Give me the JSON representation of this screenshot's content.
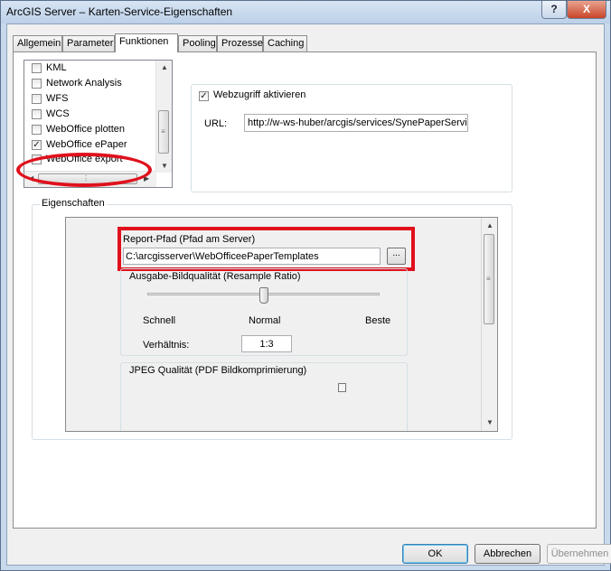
{
  "window": {
    "title": "ArcGIS Server – Karten-Service-Eigenschaften",
    "help_label": "?",
    "close_label": "X"
  },
  "tabs": [
    {
      "label": "Allgemein"
    },
    {
      "label": "Parameter"
    },
    {
      "label": "Funktionen",
      "active": true
    },
    {
      "label": "Pooling"
    },
    {
      "label": "Prozesse"
    },
    {
      "label": "Caching"
    }
  ],
  "capabilities": {
    "items": [
      {
        "label": "KML",
        "checked": false
      },
      {
        "label": "Network Analysis",
        "checked": false
      },
      {
        "label": "WFS",
        "checked": false
      },
      {
        "label": "WCS",
        "checked": false
      },
      {
        "label": "WebOffice plotten",
        "checked": false
      },
      {
        "label": "WebOffice ePaper",
        "checked": true
      },
      {
        "label": "WebOffice export",
        "checked": false
      }
    ]
  },
  "web_access": {
    "checkbox_label": "Webzugriff aktivieren",
    "checked": true,
    "url_label": "URL:",
    "url_value": "http://w-ws-huber/arcgis/services/SynePaperServic"
  },
  "properties": {
    "group_title": "Eigenschaften",
    "report_path_label": "Report-Pfad (Pfad am Server)",
    "report_path_value": "C:\\arcgisserver\\WebOfficeePaperTemplates",
    "browse_label": "...",
    "quality": {
      "title": "Ausgabe-Bildqualität (Resample Ratio)",
      "slider_value": "Normal",
      "label_low": "Schnell",
      "label_mid": "Normal",
      "label_high": "Beste",
      "ratio_label": "Verhältnis:",
      "ratio_value": "1:3"
    },
    "jpeg_title": "JPEG Qualität (PDF Bildkomprimierung)"
  },
  "buttons": {
    "ok": "OK",
    "cancel": "Abbrechen",
    "apply": "Übernehmen"
  },
  "colors": {
    "highlight_red": "#e0101c",
    "title_bar": "#c9d9ec"
  }
}
